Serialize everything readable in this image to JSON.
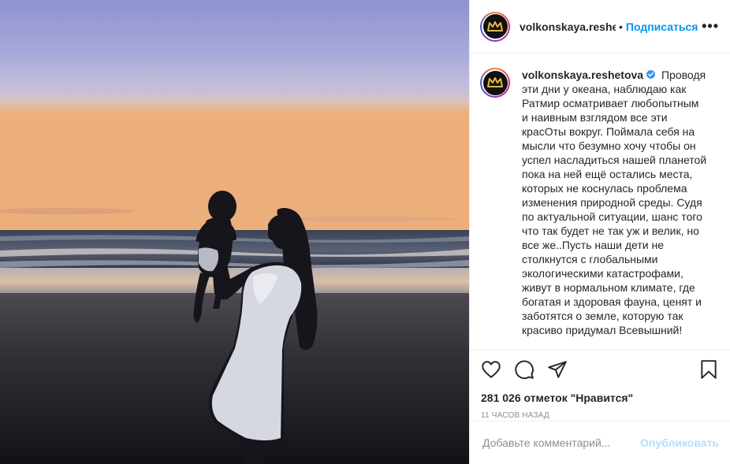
{
  "post": {
    "username": "volkonskaya.reshetova",
    "header_username": "volkonskaya.reshetova",
    "dot": "•",
    "follow_label": "Подписаться",
    "more_label": "•••",
    "caption_text": "Проводя эти дни у океана, наблюдаю как Ратмир осматривает любопытным и наивным взглядом все эти красОты вокруг. Поймала себя на мысли что безумно хочу чтобы он успел насладиться нашей планетой пока на ней ещё остались места, которых не коснулась проблема изменения природной среды. Судя по актуальной ситуации, шанс того что так будет не так уж и велик, но все же..Пусть наши дети не столкнутся с глобальными экологическими катастрофами, живут в нормальном климате, где богатая и здоровая фауна, ценят и заботятся о земле, которую так красиво придумал Всевышний!",
    "likes_text": "281 026 отметок \"Нравится\"",
    "time_text": "11 ЧАСОВ НАЗАД",
    "comment_placeholder": "Добавьте комментарий...",
    "publish_label": "Опубликовать"
  },
  "icons": {
    "like": "heart-icon",
    "comment": "comment-icon",
    "share": "share-icon",
    "save": "bookmark-icon",
    "verified": "verified-badge-icon",
    "avatar_logo": "crown-icon"
  },
  "colors": {
    "link": "#0095f6",
    "publish_disabled": "#b2dffc",
    "muted": "#8e8e8e",
    "text": "#262626",
    "verified": "#3897f0"
  }
}
